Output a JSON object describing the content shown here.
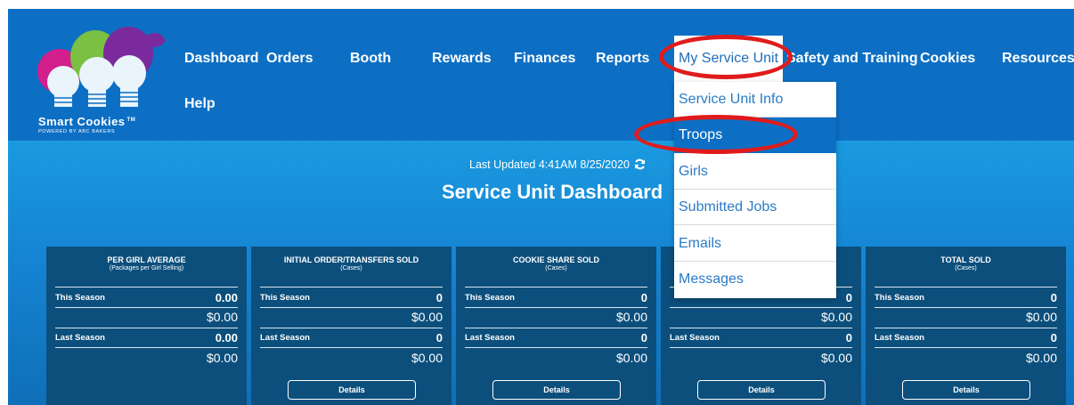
{
  "logo": {
    "name": "Smart Cookies",
    "tm": "TM",
    "tagline": "POWERED BY ABC BAKERS"
  },
  "nav": {
    "dashboard": "Dashboard",
    "orders": "Orders",
    "booth": "Booth",
    "rewards": "Rewards",
    "finances": "Finances",
    "reports": "Reports",
    "my_service_unit": "My Service Unit",
    "safety_training": "Safety and Training",
    "cookies": "Cookies",
    "resources": "Resources",
    "help": "Help"
  },
  "dropdown": {
    "items": [
      {
        "label": "Service Unit Info"
      },
      {
        "label": "Troops"
      },
      {
        "label": "Girls"
      },
      {
        "label": "Submitted Jobs"
      },
      {
        "label": "Emails"
      },
      {
        "label": "Messages"
      }
    ],
    "selected": "Troops"
  },
  "last_updated": "Last Updated 4:41AM 8/25/2020",
  "page_title": "Service Unit Dashboard",
  "cards": [
    {
      "title": "PER GIRL AVERAGE",
      "subtitle": "(Packages per Girl Selling)",
      "this_label": "This Season",
      "this_value": "0.00",
      "this_money": "$0.00",
      "last_label": "Last Season",
      "last_value": "0.00",
      "last_money": "$0.00",
      "details": ""
    },
    {
      "title": "INITIAL ORDER/TRANSFERS SOLD",
      "subtitle": "(Cases)",
      "this_label": "This Season",
      "this_value": "0",
      "this_money": "$0.00",
      "last_label": "Last Season",
      "last_value": "0",
      "last_money": "$0.00",
      "details": "Details"
    },
    {
      "title": "COOKIE SHARE SOLD",
      "subtitle": "(Cases)",
      "this_label": "This Season",
      "this_value": "0",
      "this_money": "$0.00",
      "last_label": "Last Season",
      "last_value": "0",
      "last_money": "$0.00",
      "details": "Details"
    },
    {
      "title": "",
      "subtitle": "",
      "this_label": "",
      "this_value": "0",
      "this_money": "$0.00",
      "last_label": "Last Season",
      "last_value": "0",
      "last_money": "$0.00",
      "details": "Details"
    },
    {
      "title": "TOTAL SOLD",
      "subtitle": "(Cases)",
      "this_label": "This Season",
      "this_value": "0",
      "this_money": "$0.00",
      "last_label": "Last Season",
      "last_value": "0",
      "last_money": "$0.00",
      "details": "Details"
    }
  ],
  "colors": {
    "topbar": "#0d6fc4",
    "hero": "#1a86d4",
    "card": "#0c4f7c",
    "highlight_circle": "#e01b1b",
    "menu_link": "#2a7bc4"
  }
}
